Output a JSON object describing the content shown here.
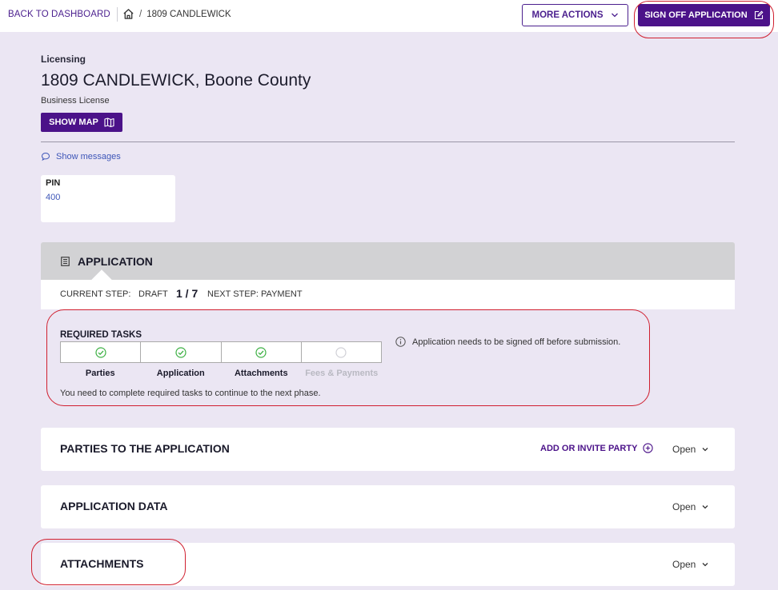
{
  "topbar": {
    "back_label": "BACK TO DASHBOARD",
    "home_icon": "home-icon",
    "breadcrumb_separator": "/",
    "breadcrumb_current": "1809 CANDLEWICK",
    "more_actions_label": "MORE ACTIONS",
    "sign_off_label": "SIGN OFF APPLICATION"
  },
  "header": {
    "section_label": "Licensing",
    "title": "1809 CANDLEWICK, Boone County",
    "subtitle": "Business License",
    "show_map_label": "SHOW MAP",
    "show_messages_label": "Show messages"
  },
  "pin_card": {
    "label": "PIN",
    "value": "400"
  },
  "application": {
    "title": "APPLICATION",
    "current_step_label": "CURRENT STEP:",
    "current_step_value": "DRAFT",
    "step_fraction": "1 / 7",
    "next_step_label": "NEXT STEP: PAYMENT",
    "required_tasks_title": "REQUIRED TASKS",
    "tasks": [
      {
        "label": "Parties",
        "done": true
      },
      {
        "label": "Application",
        "done": true
      },
      {
        "label": "Attachments",
        "done": true
      },
      {
        "label": "Fees & Payments",
        "done": false
      }
    ],
    "tasks_note": "You need to complete required tasks to continue to the next phase.",
    "info_message": "Application needs to be signed off before submission."
  },
  "panels": {
    "parties": {
      "title": "PARTIES TO THE APPLICATION",
      "action_label": "ADD OR INVITE PARTY",
      "toggle_label": "Open"
    },
    "application_data": {
      "title": "APPLICATION DATA",
      "toggle_label": "Open"
    },
    "attachments": {
      "title": "ATTACHMENTS",
      "toggle_label": "Open"
    }
  },
  "colors": {
    "brand_purple": "#4b1289",
    "page_background": "#ebe6f3",
    "success_green": "#3cb043",
    "annotation_red": "#d01f2f"
  }
}
